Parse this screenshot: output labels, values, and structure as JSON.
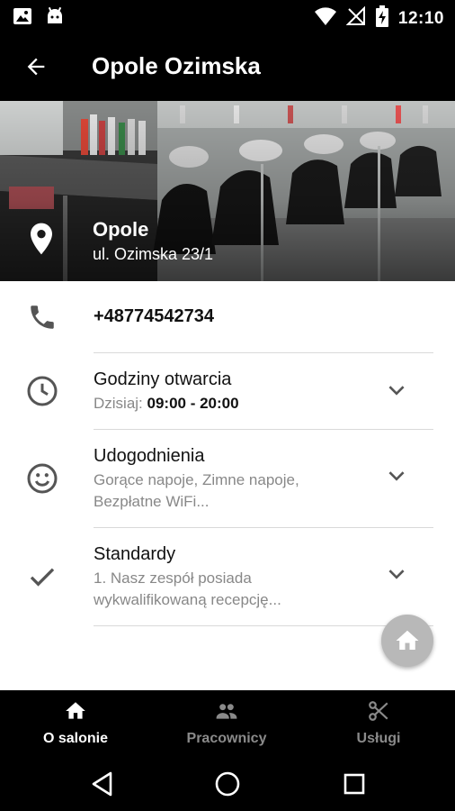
{
  "status_bar": {
    "time": "12:10"
  },
  "app_bar": {
    "title": "Opole Ozimska"
  },
  "hero": {
    "city": "Opole",
    "street": "ul. Ozimska 23/1"
  },
  "contact": {
    "phone": "+48774542734"
  },
  "hours": {
    "title": "Godziny otwarcia",
    "today_label": "Dzisiaj: ",
    "today_hours": "09:00 - 20:00"
  },
  "amenities": {
    "title": "Udogodnienia",
    "line1": "Gorące napoje, Zimne napoje,",
    "line2": "Bezpłatne WiFi..."
  },
  "standards": {
    "title": "Standardy",
    "line1": "1. Nasz zespół posiada",
    "line2": "wykwalifikowaną recepcję..."
  },
  "bottom_nav": {
    "items": [
      {
        "label": "O salonie",
        "icon": "home-icon",
        "active": true
      },
      {
        "label": "Pracownicy",
        "icon": "people-icon",
        "active": false
      },
      {
        "label": "Usługi",
        "icon": "scissors-icon",
        "active": false
      }
    ],
    "active_color": "#ffffff",
    "inactive_color": "#8a8a8a"
  },
  "colors": {
    "bar_background": "#000000",
    "fab": "#b8b8b8",
    "icon_gray": "#555555"
  }
}
